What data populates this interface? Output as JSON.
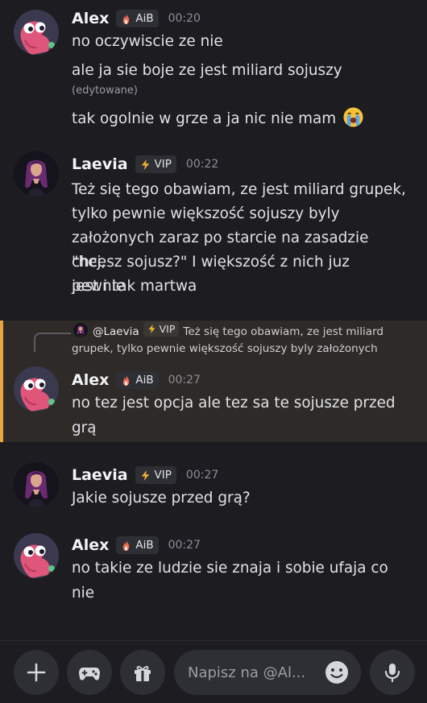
{
  "messages": [
    {
      "author": "Alex",
      "badge": "AiB",
      "badge_icon": "fire-icon",
      "time": "00:20",
      "avatar": "pink-worm-avatar",
      "lines": [
        "no oczywiscie ze nie",
        "ale ja sie boje ze jest miliard sojuszy"
      ],
      "edited": "(edytowane)",
      "lines_after": [
        "tak ogolnie w grze a ja nic nie mam"
      ],
      "emoji": "loudly-crying-face-emoji"
    },
    {
      "author": "Laevia",
      "badge": "VIP",
      "badge_icon": "lightning-icon",
      "time": "00:22",
      "avatar": "woman-purple-hair-avatar",
      "lines": [
        "Też się tego obawiam, ze jest miliard grupek,",
        "tylko pewnie większość sojuszy byly",
        "założonych zaraz po starcie na zasadzie \"hej,",
        "chcesz sojusz?\" I większość z nich juz pewnie",
        "jest i tak martwa"
      ]
    },
    {
      "reply_to": {
        "author": "@Laevia",
        "badge": "VIP",
        "line1": "Też się tego obawiam, ze jest miliard",
        "line2": "grupek, tylko pewnie większość sojuszy byly założonych"
      },
      "author": "Alex",
      "badge": "AiB",
      "badge_icon": "fire-icon",
      "time": "00:27",
      "lines": [
        "no tez jest opcja ale tez sa te sojusze przed",
        "grą"
      ]
    },
    {
      "author": "Laevia",
      "badge": "VIP",
      "badge_icon": "lightning-icon",
      "time": "00:27",
      "lines": [
        "Jakie sojusze przed grą?"
      ]
    },
    {
      "author": "Alex",
      "badge": "AiB",
      "badge_icon": "fire-icon",
      "time": "00:27",
      "lines": [
        "no takie ze ludzie sie znaja i sobie ufaja co",
        "nie"
      ]
    }
  ],
  "composer": {
    "placeholder": "Napisz na @Al...",
    "buttons": [
      "plus-icon",
      "gamepad-icon",
      "gift-icon",
      "emoji-icon",
      "microphone-icon"
    ]
  },
  "colors": {
    "background": "#1c1c21",
    "reply_highlight": "#2d2a27",
    "reply_bar": "#e8a640",
    "vip_lightning": "#f0b232"
  }
}
